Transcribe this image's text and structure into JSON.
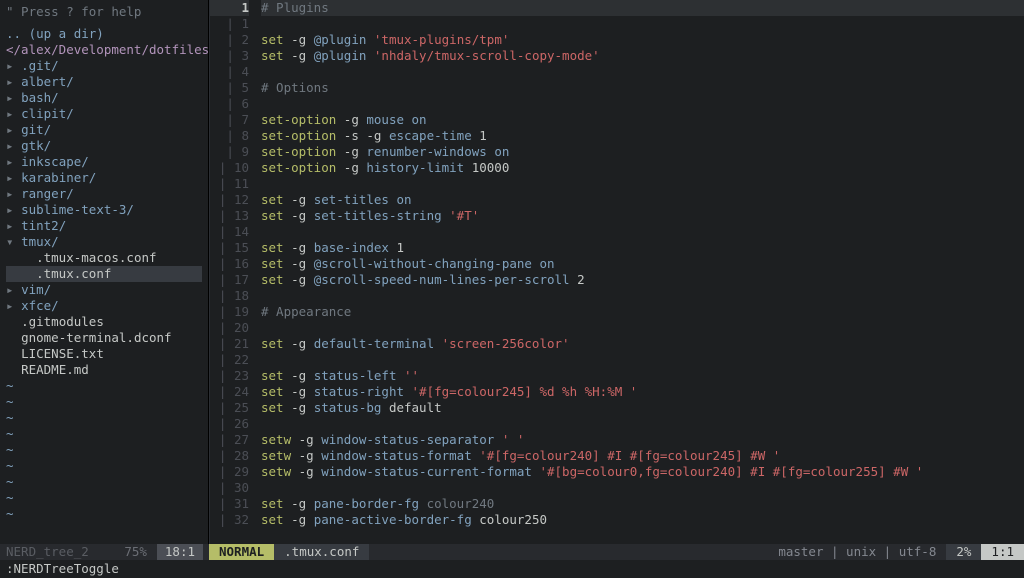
{
  "nerdtree": {
    "help": "\" Press ? for help",
    "up": ".. (up a dir)",
    "path": "</alex/Development/dotfiles/",
    "items": [
      {
        "type": "dir",
        "label": ".git/",
        "open": false,
        "depth": 0
      },
      {
        "type": "dir",
        "label": "albert/",
        "open": false,
        "depth": 0
      },
      {
        "type": "dir",
        "label": "bash/",
        "open": false,
        "depth": 0
      },
      {
        "type": "dir",
        "label": "clipit/",
        "open": false,
        "depth": 0
      },
      {
        "type": "dir",
        "label": "git/",
        "open": false,
        "depth": 0
      },
      {
        "type": "dir",
        "label": "gtk/",
        "open": false,
        "depth": 0
      },
      {
        "type": "dir",
        "label": "inkscape/",
        "open": false,
        "depth": 0
      },
      {
        "type": "dir",
        "label": "karabiner/",
        "open": false,
        "depth": 0
      },
      {
        "type": "dir",
        "label": "ranger/",
        "open": false,
        "depth": 0
      },
      {
        "type": "dir",
        "label": "sublime-text-3/",
        "open": false,
        "depth": 0
      },
      {
        "type": "dir",
        "label": "tint2/",
        "open": false,
        "depth": 0
      },
      {
        "type": "dir",
        "label": "tmux/",
        "open": true,
        "depth": 0
      },
      {
        "type": "file",
        "label": ".tmux-macos.conf",
        "depth": 1
      },
      {
        "type": "file",
        "label": ".tmux.conf",
        "depth": 1,
        "selected": true
      },
      {
        "type": "dir",
        "label": "vim/",
        "open": false,
        "depth": 0
      },
      {
        "type": "dir",
        "label": "xfce/",
        "open": false,
        "depth": 0
      },
      {
        "type": "file",
        "label": ".gitmodules",
        "depth": 0
      },
      {
        "type": "file",
        "label": "gnome-terminal.dconf",
        "depth": 0
      },
      {
        "type": "file",
        "label": "LICENSE.txt",
        "depth": 0
      },
      {
        "type": "file",
        "label": "README.md",
        "depth": 0
      }
    ],
    "status": {
      "name": "NERD_tree_2",
      "pct": "75%",
      "pos": "18:1"
    }
  },
  "editor": {
    "cursor_line": 1,
    "lines": [
      {
        "n": 1,
        "spans": [
          {
            "t": "# Plugins",
            "c": "c-com"
          }
        ]
      },
      {
        "n": 1,
        "spans": []
      },
      {
        "n": 2,
        "spans": [
          {
            "t": "set ",
            "c": "c-cmd"
          },
          {
            "t": "-g ",
            "c": "c-flag"
          },
          {
            "t": "@plugin ",
            "c": "c-opt"
          },
          {
            "t": "'tmux-plugins/tpm'",
            "c": "c-str"
          }
        ]
      },
      {
        "n": 3,
        "spans": [
          {
            "t": "set ",
            "c": "c-cmd"
          },
          {
            "t": "-g ",
            "c": "c-flag"
          },
          {
            "t": "@plugin ",
            "c": "c-opt"
          },
          {
            "t": "'nhdaly/tmux-scroll-copy-mode'",
            "c": "c-str"
          }
        ]
      },
      {
        "n": 4,
        "spans": []
      },
      {
        "n": 5,
        "spans": [
          {
            "t": "# Options",
            "c": "c-com"
          }
        ]
      },
      {
        "n": 6,
        "spans": []
      },
      {
        "n": 7,
        "spans": [
          {
            "t": "set-option ",
            "c": "c-cmd"
          },
          {
            "t": "-g ",
            "c": "c-flag"
          },
          {
            "t": "mouse ",
            "c": "c-opt"
          },
          {
            "t": "on",
            "c": "c-on"
          }
        ]
      },
      {
        "n": 8,
        "spans": [
          {
            "t": "set-option ",
            "c": "c-cmd"
          },
          {
            "t": "-s -g ",
            "c": "c-flag"
          },
          {
            "t": "escape-time ",
            "c": "c-opt"
          },
          {
            "t": "1",
            "c": "c-num"
          }
        ]
      },
      {
        "n": 9,
        "spans": [
          {
            "t": "set-option ",
            "c": "c-cmd"
          },
          {
            "t": "-g ",
            "c": "c-flag"
          },
          {
            "t": "renumber-windows ",
            "c": "c-opt"
          },
          {
            "t": "on",
            "c": "c-on"
          }
        ]
      },
      {
        "n": 10,
        "spans": [
          {
            "t": "set-option ",
            "c": "c-cmd"
          },
          {
            "t": "-g ",
            "c": "c-flag"
          },
          {
            "t": "history-limit ",
            "c": "c-opt"
          },
          {
            "t": "10000",
            "c": "c-num"
          }
        ]
      },
      {
        "n": 11,
        "spans": []
      },
      {
        "n": 12,
        "spans": [
          {
            "t": "set ",
            "c": "c-cmd"
          },
          {
            "t": "-g ",
            "c": "c-flag"
          },
          {
            "t": "set-titles ",
            "c": "c-opt"
          },
          {
            "t": "on",
            "c": "c-on"
          }
        ]
      },
      {
        "n": 13,
        "spans": [
          {
            "t": "set ",
            "c": "c-cmd"
          },
          {
            "t": "-g ",
            "c": "c-flag"
          },
          {
            "t": "set-titles-string ",
            "c": "c-opt"
          },
          {
            "t": "'#T'",
            "c": "c-str"
          }
        ]
      },
      {
        "n": 14,
        "spans": []
      },
      {
        "n": 15,
        "spans": [
          {
            "t": "set ",
            "c": "c-cmd"
          },
          {
            "t": "-g ",
            "c": "c-flag"
          },
          {
            "t": "base-index ",
            "c": "c-opt"
          },
          {
            "t": "1",
            "c": "c-num"
          }
        ]
      },
      {
        "n": 16,
        "spans": [
          {
            "t": "set ",
            "c": "c-cmd"
          },
          {
            "t": "-g ",
            "c": "c-flag"
          },
          {
            "t": "@scroll-without-changing-pane ",
            "c": "c-opt"
          },
          {
            "t": "on",
            "c": "c-on"
          }
        ]
      },
      {
        "n": 17,
        "spans": [
          {
            "t": "set ",
            "c": "c-cmd"
          },
          {
            "t": "-g ",
            "c": "c-flag"
          },
          {
            "t": "@scroll-speed-num-lines-per-scroll ",
            "c": "c-opt"
          },
          {
            "t": "2",
            "c": "c-num"
          }
        ]
      },
      {
        "n": 18,
        "spans": []
      },
      {
        "n": 19,
        "spans": [
          {
            "t": "# Appearance",
            "c": "c-com"
          }
        ]
      },
      {
        "n": 20,
        "spans": []
      },
      {
        "n": 21,
        "spans": [
          {
            "t": "set ",
            "c": "c-cmd"
          },
          {
            "t": "-g ",
            "c": "c-flag"
          },
          {
            "t": "default-terminal ",
            "c": "c-opt"
          },
          {
            "t": "'screen-256color'",
            "c": "c-str"
          }
        ]
      },
      {
        "n": 22,
        "spans": []
      },
      {
        "n": 23,
        "spans": [
          {
            "t": "set ",
            "c": "c-cmd"
          },
          {
            "t": "-g ",
            "c": "c-flag"
          },
          {
            "t": "status-left ",
            "c": "c-opt"
          },
          {
            "t": "''",
            "c": "c-str"
          }
        ]
      },
      {
        "n": 24,
        "spans": [
          {
            "t": "set ",
            "c": "c-cmd"
          },
          {
            "t": "-g ",
            "c": "c-flag"
          },
          {
            "t": "status-right ",
            "c": "c-opt"
          },
          {
            "t": "'#[fg=colour245] %d %h %H:%M '",
            "c": "c-str"
          }
        ]
      },
      {
        "n": 25,
        "spans": [
          {
            "t": "set ",
            "c": "c-cmd"
          },
          {
            "t": "-g ",
            "c": "c-flag"
          },
          {
            "t": "status-bg ",
            "c": "c-opt"
          },
          {
            "t": "default",
            "c": "c-num"
          }
        ]
      },
      {
        "n": 26,
        "spans": []
      },
      {
        "n": 27,
        "spans": [
          {
            "t": "setw ",
            "c": "c-cmd"
          },
          {
            "t": "-g ",
            "c": "c-flag"
          },
          {
            "t": "window-status-separator ",
            "c": "c-opt"
          },
          {
            "t": "' '",
            "c": "c-str"
          }
        ]
      },
      {
        "n": 28,
        "spans": [
          {
            "t": "setw ",
            "c": "c-cmd"
          },
          {
            "t": "-g ",
            "c": "c-flag"
          },
          {
            "t": "window-status-format ",
            "c": "c-opt"
          },
          {
            "t": "'#[fg=colour240] #I #[fg=colour245] #W '",
            "c": "c-str"
          }
        ]
      },
      {
        "n": 29,
        "spans": [
          {
            "t": "setw ",
            "c": "c-cmd"
          },
          {
            "t": "-g ",
            "c": "c-flag"
          },
          {
            "t": "window-status-current-format ",
            "c": "c-opt"
          },
          {
            "t": "'#[bg=colour0,fg=colour240] #I #[fg=colour255] #W '",
            "c": "c-str"
          }
        ]
      },
      {
        "n": 30,
        "spans": []
      },
      {
        "n": 31,
        "spans": [
          {
            "t": "set ",
            "c": "c-cmd"
          },
          {
            "t": "-g ",
            "c": "c-flag"
          },
          {
            "t": "pane-border-fg ",
            "c": "c-opt"
          },
          {
            "t": "colour240",
            "c": "c-com"
          }
        ]
      },
      {
        "n": 32,
        "spans": [
          {
            "t": "set ",
            "c": "c-cmd"
          },
          {
            "t": "-g ",
            "c": "c-flag"
          },
          {
            "t": "pane-active-border-fg ",
            "c": "c-opt"
          },
          {
            "t": "colour250",
            "c": "c-num"
          }
        ]
      }
    ],
    "status": {
      "mode": "NORMAL",
      "fname": ".tmux.conf",
      "vcs": "master | unix | utf-8",
      "pct": "2%",
      "pos": "1:1"
    }
  },
  "cmdline": ":NERDTreeToggle"
}
